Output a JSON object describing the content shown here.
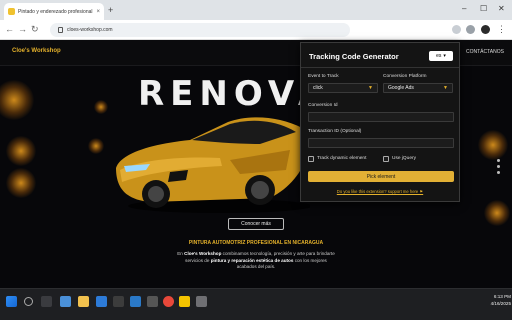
{
  "browser": {
    "tab_title": "Pintado y enderezado profesional",
    "tab_close": "×",
    "new_tab": "+",
    "url": "cloes-workshop.com",
    "window_controls": [
      "–",
      "☐",
      "✕"
    ]
  },
  "site": {
    "logo": "Cloe's Workshop",
    "contact": "CONTÁCTANOS",
    "hero_title": "RENOVÁ",
    "cta": "Conocer más",
    "tagline": "PINTURA AUTOMOTRIZ PROFESIONAL EN NICARAGUA",
    "desc_intro": "En",
    "desc_brand": "Cloe's Workshop",
    "desc_mid": "combinamos tecnología, precisión y arte para brindarte servicios de",
    "desc_services": "pintura y reparación estética de autos",
    "desc_end": "con los mejores acabados del país."
  },
  "popup": {
    "title": "Tracking Code Generator",
    "language": "es",
    "event_label": "Event to Track",
    "event_value": "click",
    "platform_label": "Conversion Platform",
    "platform_value": "Google Ads",
    "conversion_id_label": "Conversion Id",
    "transaction_id_label": "Transaction ID (Optional)",
    "track_dynamic_label": "Track dynamic element",
    "use_jquery_label": "Use jQuery",
    "pick_button": "Pick element",
    "feedback_link": "Do you like this extension? support me here ⚑"
  },
  "taskbar": {
    "time": "6:13 PM",
    "date": "4/16/2025"
  },
  "colors": {
    "accent": "#e2b035",
    "brand": "#e4b12b",
    "popup_bg": "#141414",
    "site_bg": "#07070a"
  }
}
